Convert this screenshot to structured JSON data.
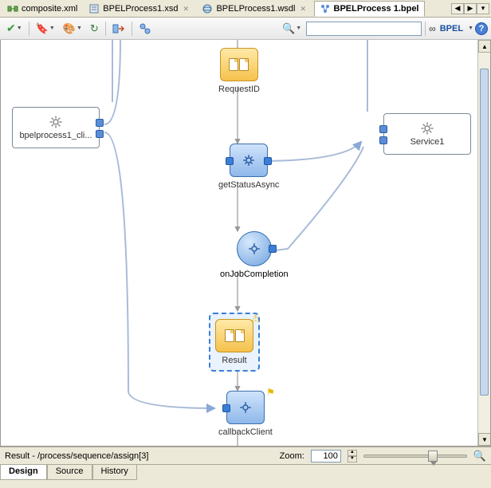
{
  "tabs": [
    {
      "label": "composite.xml",
      "active": false
    },
    {
      "label": "BPELProcess1.xsd",
      "active": false
    },
    {
      "label": "BPELProcess1.wsdl",
      "active": false
    },
    {
      "label": "BPELProcess 1.bpel",
      "active": true
    }
  ],
  "toolbar": {
    "mode_label": "BPEL"
  },
  "partners": {
    "left": {
      "label": "bpelprocess1_cli..."
    },
    "right": {
      "label": "Service1"
    }
  },
  "activities": {
    "requestId": {
      "label": "RequestID"
    },
    "getStatusAsync": {
      "label": "getStatusAsync"
    },
    "onJobCompletion": {
      "label": "onJobCompletion"
    },
    "result": {
      "label": "Result"
    },
    "callbackClient": {
      "label": "callbackClient"
    }
  },
  "status": {
    "path": "Result - /process/sequence/assign[3]",
    "zoom_label": "Zoom:",
    "zoom_value": "100"
  },
  "bottom_tabs": [
    {
      "label": "Design",
      "active": true
    },
    {
      "label": "Source",
      "active": false
    },
    {
      "label": "History",
      "active": false
    }
  ]
}
